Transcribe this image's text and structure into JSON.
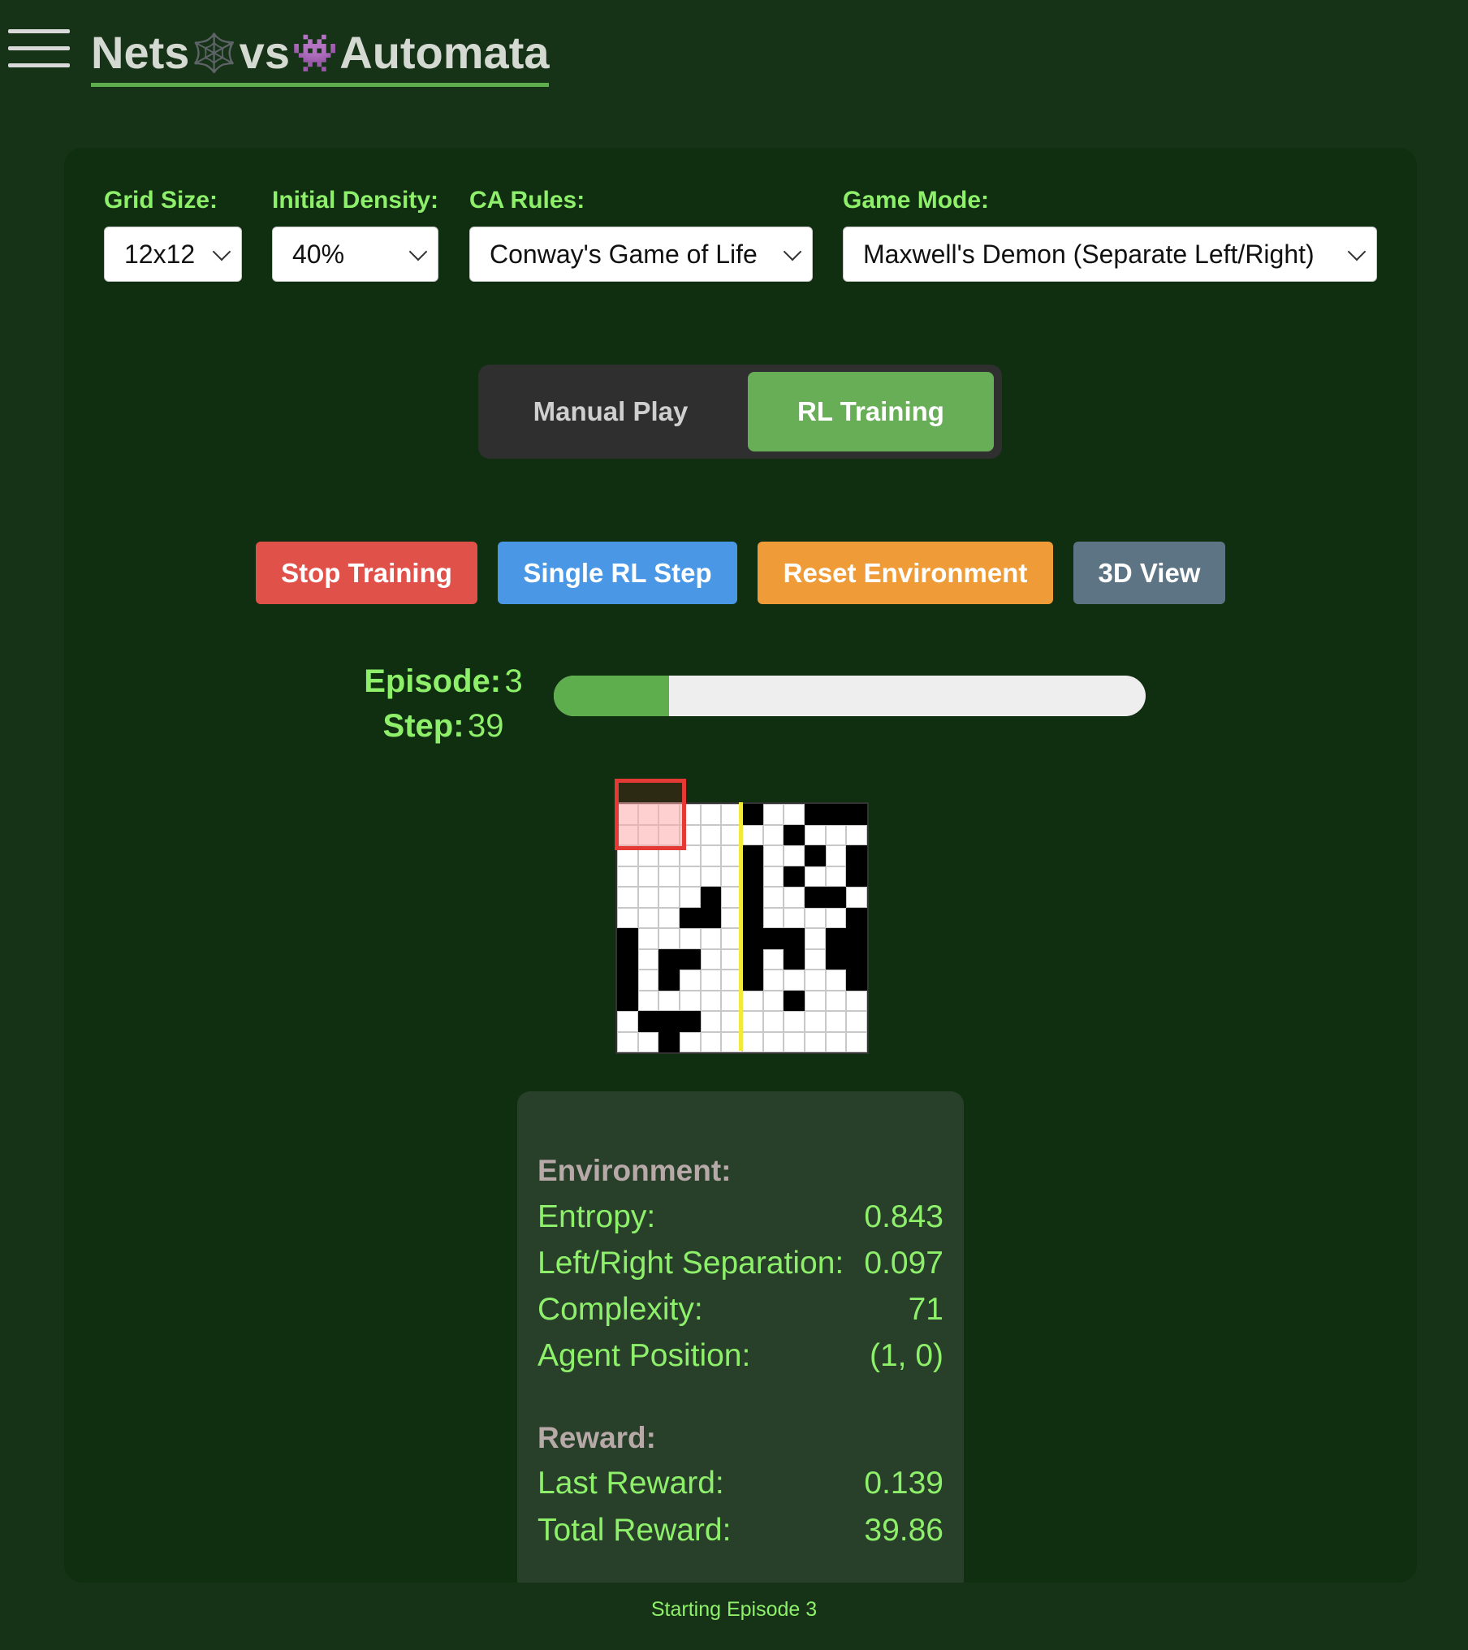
{
  "header": {
    "title_part1": "Nets",
    "title_part2": "vs",
    "title_part3": "Automata",
    "emoji_web": "🕸️",
    "emoji_invader": "👾"
  },
  "controls": {
    "grid_size": {
      "label": "Grid Size:",
      "value": "12x12"
    },
    "density": {
      "label": "Initial Density:",
      "value": "40%"
    },
    "ca_rules": {
      "label": "CA Rules:",
      "value": "Conway's Game of Life"
    },
    "game_mode": {
      "label": "Game Mode:",
      "value": "Maxwell's Demon (Separate Left/Right)"
    }
  },
  "mode_toggle": {
    "manual": "Manual Play",
    "rl": "RL Training",
    "active": "rl"
  },
  "actions": {
    "stop": "Stop Training",
    "step": "Single RL Step",
    "reset": "Reset Environment",
    "view3d": "3D View"
  },
  "colors": {
    "stop": "#e0514a",
    "step": "#4a97e6",
    "reset": "#ef9c38",
    "view3d": "#5c7483",
    "accent": "#8ef06a",
    "progress": "#5fae4d"
  },
  "progress": {
    "episode_label": "Episode:",
    "episode": "3",
    "step_label": "Step:",
    "step": "39",
    "fraction": 0.195
  },
  "grid": {
    "size": 12,
    "agent_position": [
      1,
      0
    ],
    "rows": [
      "000000100111",
      "000000001000",
      "000000100101",
      "000000101001",
      "000010100110",
      "000110100001",
      "100000111011",
      "101100101011",
      "101000100001",
      "100000001000",
      "011100000000",
      "001000000000"
    ]
  },
  "stats": {
    "env_head": "Environment:",
    "entropy_label": "Entropy:",
    "entropy": "0.843",
    "separation_label": "Left/Right Separation:",
    "separation": "0.097",
    "complexity_label": "Complexity:",
    "complexity": "71",
    "agent_pos_label": "Agent Position:",
    "agent_pos": "(1, 0)",
    "reward_head": "Reward:",
    "last_reward_label": "Last Reward:",
    "last_reward": "0.139",
    "total_reward_label": "Total Reward:",
    "total_reward": "39.86"
  },
  "status": "Starting Episode 3"
}
